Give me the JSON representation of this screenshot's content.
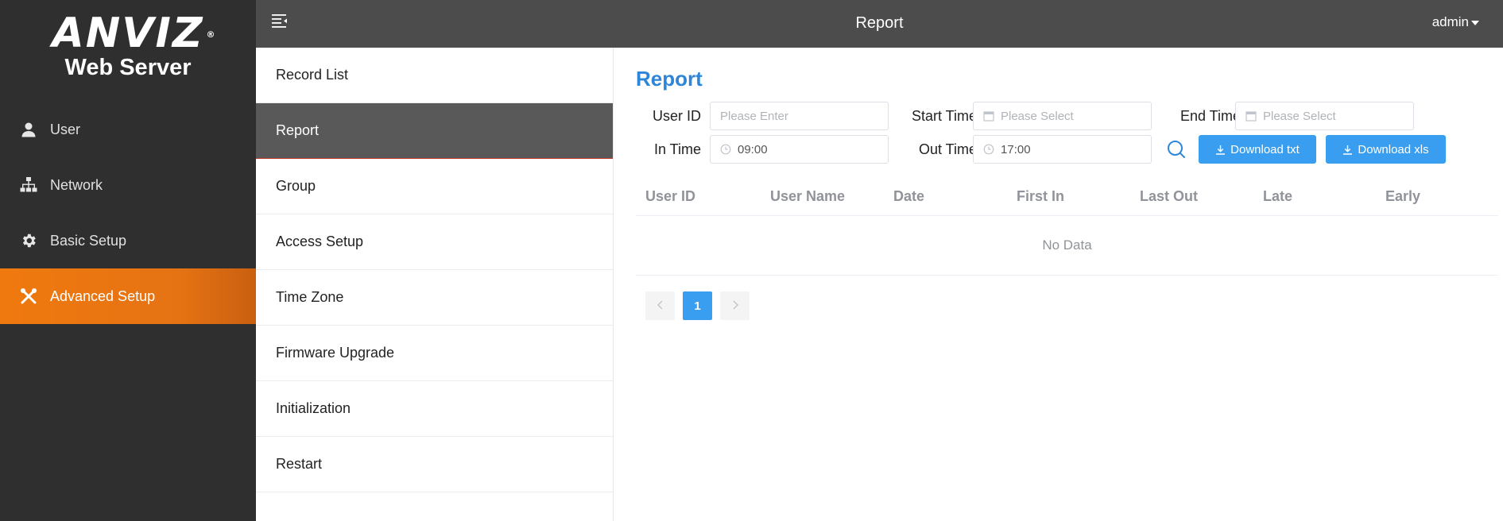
{
  "brand": {
    "logo": "ANVIZ",
    "reg": "®",
    "subtitle": "Web Server"
  },
  "sidebar": {
    "items": [
      {
        "label": "User",
        "icon": "user-icon",
        "active": false
      },
      {
        "label": "Network",
        "icon": "network-icon",
        "active": false
      },
      {
        "label": "Basic Setup",
        "icon": "gear-icon",
        "active": false
      },
      {
        "label": "Advanced Setup",
        "icon": "tools-icon",
        "active": true
      }
    ]
  },
  "topbar": {
    "title": "Report",
    "user": "admin"
  },
  "submenu": {
    "items": [
      {
        "label": "Record List"
      },
      {
        "label": "Report"
      },
      {
        "label": "Group"
      },
      {
        "label": "Access Setup"
      },
      {
        "label": "Time Zone"
      },
      {
        "label": "Firmware Upgrade"
      },
      {
        "label": "Initialization"
      },
      {
        "label": "Restart"
      }
    ]
  },
  "main": {
    "title": "Report",
    "form": {
      "user_id_label": "User ID",
      "user_id_placeholder": "Please Enter",
      "start_time_label": "Start Time",
      "start_time_placeholder": "Please Select",
      "end_time_label": "End Time",
      "end_time_placeholder": "Please Select",
      "in_time_label": "In Time",
      "in_time_value": "09:00",
      "out_time_label": "Out Time",
      "out_time_value": "17:00",
      "download_txt": "Download txt",
      "download_xls": "Download xls"
    },
    "table": {
      "columns": [
        "User ID",
        "User Name",
        "Date",
        "First In",
        "Last Out",
        "Late",
        "Early"
      ],
      "empty_text": "No Data"
    },
    "pagination": {
      "current": "1"
    }
  },
  "colors": {
    "accent": "#3a9ef0",
    "title_blue": "#2e86d8",
    "active_orange": "#f0790f",
    "sidebar_bg": "#2f2f2f",
    "topbar_bg": "#4c4c4c"
  }
}
